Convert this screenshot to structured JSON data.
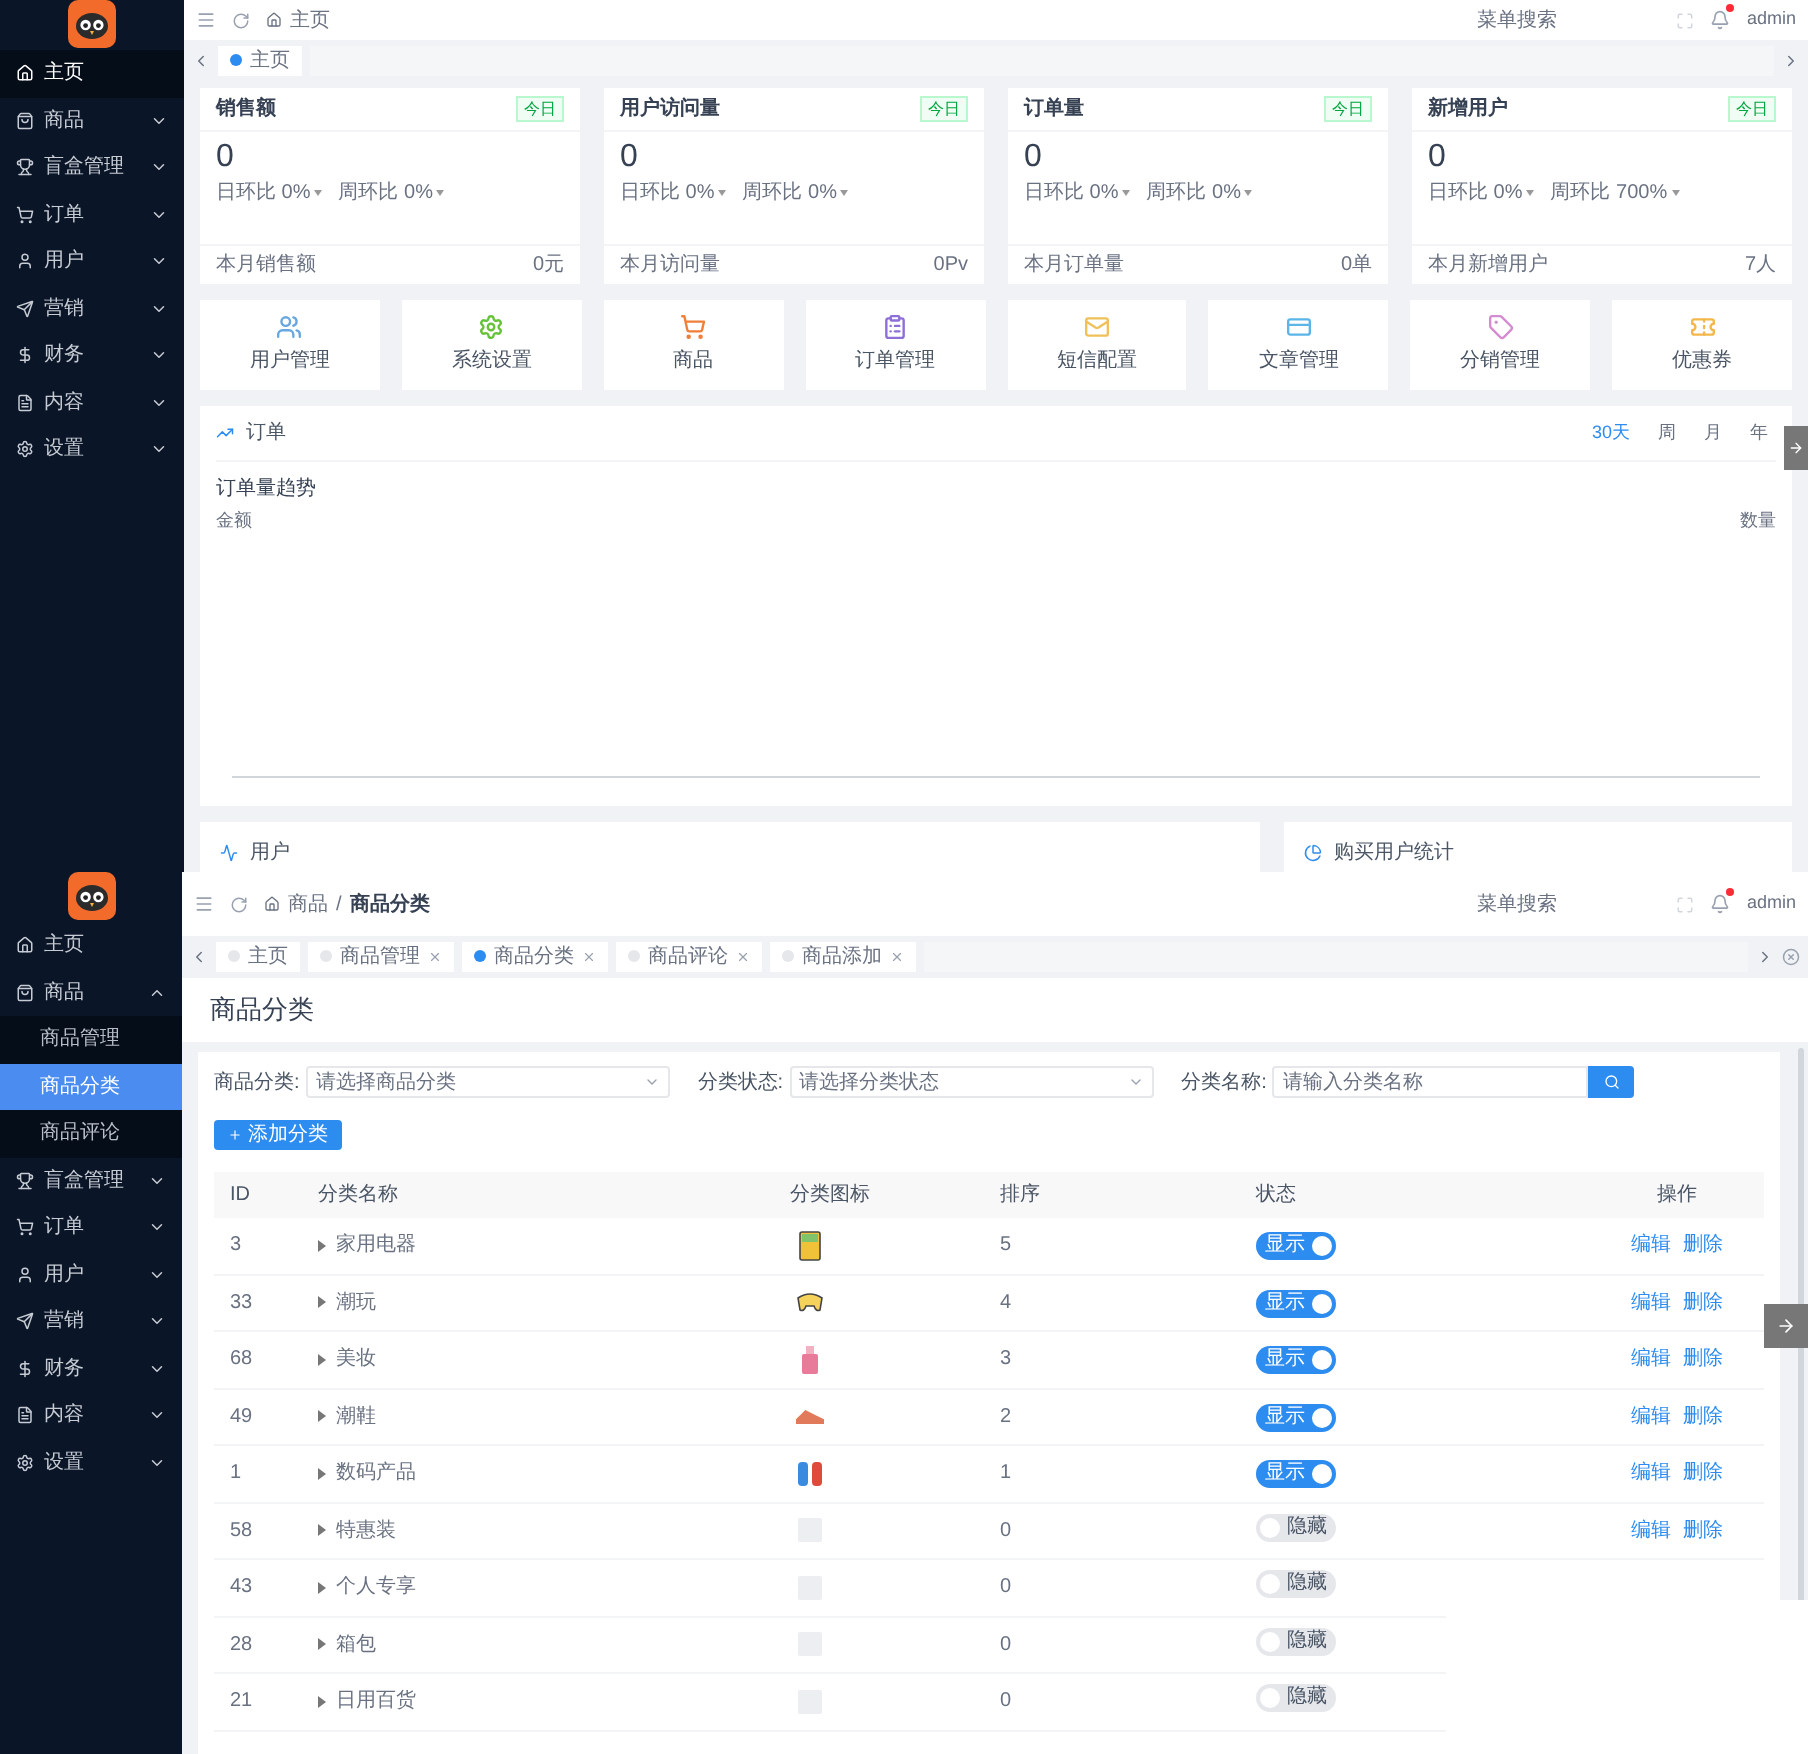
{
  "top": {
    "menu": [
      {
        "label": "主页",
        "selected": true,
        "expandable": false
      },
      {
        "label": "商品",
        "selected": false,
        "expandable": true
      },
      {
        "label": "盲盒管理",
        "selected": false,
        "expandable": true
      },
      {
        "label": "订单",
        "selected": false,
        "expandable": true
      },
      {
        "label": "用户",
        "selected": false,
        "expandable": true
      },
      {
        "label": "营销",
        "selected": false,
        "expandable": true
      },
      {
        "label": "财务",
        "selected": false,
        "expandable": true
      },
      {
        "label": "内容",
        "selected": false,
        "expandable": true
      },
      {
        "label": "设置",
        "selected": false,
        "expandable": true
      }
    ],
    "breadcrumb": [
      "主页"
    ],
    "search_placeholder": "菜单搜索",
    "unread": true,
    "user": "admin",
    "tabs": [
      {
        "label": "主页",
        "selected": true,
        "closable": false
      }
    ],
    "stats": [
      {
        "title": "销售额",
        "tag": "今日",
        "value": "0",
        "day_ratio": "日环比 0%",
        "week_ratio": "周环比 0%",
        "footer_label": "本月销售额",
        "footer_value": "0元"
      },
      {
        "title": "用户访问量",
        "tag": "今日",
        "value": "0",
        "day_ratio": "日环比 0%",
        "week_ratio": "周环比 0%",
        "footer_label": "本月访问量",
        "footer_value": "0Pv"
      },
      {
        "title": "订单量",
        "tag": "今日",
        "value": "0",
        "day_ratio": "日环比 0%",
        "week_ratio": "周环比 0%",
        "footer_label": "本月订单量",
        "footer_value": "0单"
      },
      {
        "title": "新增用户",
        "tag": "今日",
        "value": "0",
        "day_ratio": "日环比 0%",
        "week_ratio": "周环比 700%",
        "footer_label": "本月新增用户",
        "footer_value": "7人"
      }
    ],
    "shortcuts": [
      {
        "label": "用户管理",
        "color": "#69a7e0"
      },
      {
        "label": "系统设置",
        "color": "#67c23a"
      },
      {
        "label": "商品",
        "color": "#ef7f3a"
      },
      {
        "label": "订单管理",
        "color": "#8e6fd8"
      },
      {
        "label": "短信配置",
        "color": "#f0c05a"
      },
      {
        "label": "文章管理",
        "color": "#5bb5e8"
      },
      {
        "label": "分销管理",
        "color": "#d58bd0"
      },
      {
        "label": "优惠券",
        "color": "#f2b84b"
      }
    ],
    "order_panel": {
      "title": "订单",
      "periods": [
        {
          "label": "30天",
          "selected": true
        },
        {
          "label": "周",
          "selected": false
        },
        {
          "label": "月",
          "selected": false
        },
        {
          "label": "年",
          "selected": false
        }
      ],
      "subtitle": "订单量趋势",
      "left_axis": "金额",
      "right_axis": "数量"
    },
    "bottom_cards": [
      "用户",
      "购买用户统计"
    ]
  },
  "bottom": {
    "menu": [
      {
        "label": "主页",
        "selected": false,
        "expandable": false
      },
      {
        "label": "商品",
        "selected": false,
        "expandable": true,
        "expanded": true,
        "children": [
          {
            "label": "商品管理",
            "selected": false
          },
          {
            "label": "商品分类",
            "selected": true
          },
          {
            "label": "商品评论",
            "selected": false
          }
        ]
      },
      {
        "label": "盲盒管理",
        "selected": false,
        "expandable": true,
        "expanded": false
      },
      {
        "label": "订单",
        "selected": false,
        "expandable": true,
        "expanded": false
      },
      {
        "label": "用户",
        "selected": false,
        "expandable": true,
        "expanded": false
      },
      {
        "label": "营销",
        "selected": false,
        "expandable": true,
        "expanded": false
      },
      {
        "label": "财务",
        "selected": false,
        "expandable": true,
        "expanded": false
      },
      {
        "label": "内容",
        "selected": false,
        "expandable": true,
        "expanded": false
      },
      {
        "label": "设置",
        "selected": false,
        "expandable": true,
        "expanded": false
      }
    ],
    "breadcrumb": [
      "商品",
      "商品分类"
    ],
    "breadcrumb_separator": "/",
    "search_placeholder": "菜单搜索",
    "unread": true,
    "user": "admin",
    "tabs": [
      {
        "label": "主页",
        "selected": false,
        "closable": false
      },
      {
        "label": "商品管理",
        "selected": false,
        "closable": true
      },
      {
        "label": "商品分类",
        "selected": true,
        "closable": true
      },
      {
        "label": "商品评论",
        "selected": false,
        "closable": true
      },
      {
        "label": "商品添加",
        "selected": false,
        "closable": true
      }
    ],
    "page_title": "商品分类",
    "filters": [
      {
        "label": "商品分类:",
        "placeholder": "请选择商品分类",
        "kind": "select"
      },
      {
        "label": "分类状态:",
        "placeholder": "请选择分类状态",
        "kind": "select"
      },
      {
        "label": "分类名称:",
        "placeholder": "请输入分类名称",
        "kind": "input"
      }
    ],
    "add_button": "添加分类",
    "columns": [
      "ID",
      "分类名称",
      "分类图标",
      "排序",
      "状态",
      "操作"
    ],
    "rows": [
      {
        "id": "3",
        "name": "家用电器",
        "has_icon": true,
        "sort": "5",
        "status": {
          "on": true,
          "label": "显示"
        },
        "actions": [
          "编辑",
          "删除"
        ]
      },
      {
        "id": "33",
        "name": "潮玩",
        "has_icon": true,
        "sort": "4",
        "status": {
          "on": true,
          "label": "显示"
        },
        "actions": [
          "编辑",
          "删除"
        ]
      },
      {
        "id": "68",
        "name": "美妆",
        "has_icon": true,
        "sort": "3",
        "status": {
          "on": true,
          "label": "显示"
        },
        "actions": [
          "编辑",
          "删除"
        ]
      },
      {
        "id": "49",
        "name": "潮鞋",
        "has_icon": true,
        "sort": "2",
        "status": {
          "on": true,
          "label": "显示"
        },
        "actions": [
          "编辑",
          "删除"
        ]
      },
      {
        "id": "1",
        "name": "数码产品",
        "has_icon": true,
        "sort": "1",
        "status": {
          "on": true,
          "label": "显示"
        },
        "actions": [
          "编辑",
          "删除"
        ]
      },
      {
        "id": "58",
        "name": "特惠装",
        "has_icon": false,
        "sort": "0",
        "status": {
          "on": false,
          "label": "隐藏"
        },
        "actions": [
          "编辑",
          "删除"
        ]
      },
      {
        "id": "43",
        "name": "个人专享",
        "has_icon": false,
        "sort": "0",
        "status": {
          "on": false,
          "label": "隐藏"
        }
      },
      {
        "id": "28",
        "name": "箱包",
        "has_icon": false,
        "sort": "0",
        "status": {
          "on": false,
          "label": "隐藏"
        }
      },
      {
        "id": "21",
        "name": "日用百货",
        "has_icon": false,
        "sort": "0",
        "status": {
          "on": false,
          "label": "隐藏"
        }
      }
    ]
  }
}
